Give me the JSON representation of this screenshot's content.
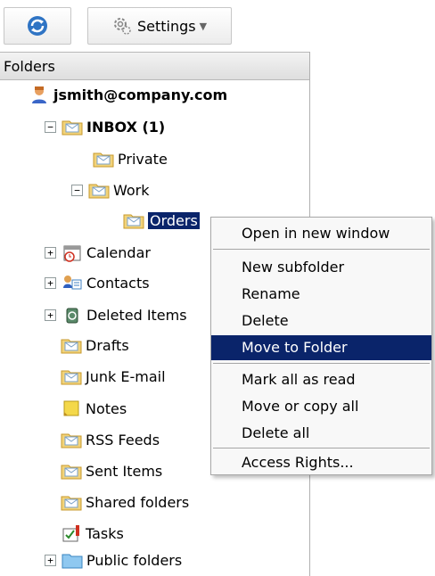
{
  "toolbar": {
    "refresh_icon": "refresh-icon",
    "settings_label": "Settings",
    "settings_icon": "gear-icon"
  },
  "panel": {
    "header": "Folders"
  },
  "tree": {
    "account": "jsmith@company.com",
    "inbox": "INBOX (1)",
    "private": "Private",
    "work": "Work",
    "orders": "Orders",
    "calendar": "Calendar",
    "contacts": "Contacts",
    "deleted": "Deleted Items",
    "drafts": "Drafts",
    "junk": "Junk E-mail",
    "notes": "Notes",
    "rss": "RSS Feeds",
    "sent": "Sent Items",
    "shared": "Shared folders",
    "tasks": "Tasks",
    "public": "Public folders"
  },
  "context_menu": {
    "open_new_window": "Open in new window",
    "new_subfolder": "New subfolder",
    "rename": "Rename",
    "delete": "Delete",
    "move_to_folder": "Move to Folder",
    "mark_all_read": "Mark all as read",
    "move_or_copy_all": "Move or copy all",
    "delete_all": "Delete all",
    "access_rights": "Access Rights..."
  },
  "colors": {
    "selection": "#0a246a",
    "folder_icon": "#f2d37a"
  }
}
